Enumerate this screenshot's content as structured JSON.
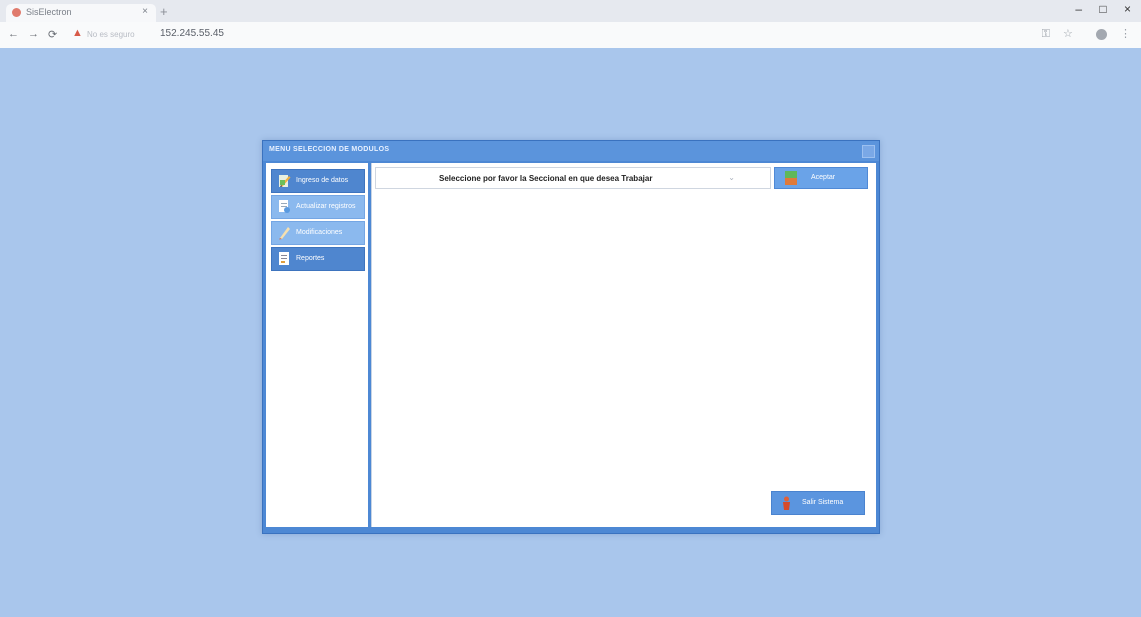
{
  "browser": {
    "tab_title": "SisElectron",
    "tab_close": "×",
    "new_tab": "+",
    "security_label": "No es seguro",
    "url": "152.245.55.45",
    "window_controls": {
      "minimize": "–",
      "maximize": "□",
      "close": "×"
    }
  },
  "dialog": {
    "title": "MENU SELECCION DE MODULOS",
    "sidebar": [
      {
        "label": "Ingreso de datos",
        "icon": "pencil-edit-icon",
        "style": "dark"
      },
      {
        "label": "Actualizar registros",
        "icon": "refresh-doc-icon",
        "style": "light"
      },
      {
        "label": "Modificaciones",
        "icon": "pen-icon",
        "style": "light"
      },
      {
        "label": "Reportes",
        "icon": "report-icon",
        "style": "dark"
      }
    ],
    "selector": {
      "text": "Seleccione por favor la Seccional en que desea Trabajar",
      "arrow": "⌄"
    },
    "accept_label": "Aceptar",
    "logout_label": "Salir Sistema"
  },
  "colors": {
    "page_bg": "#a9c6ec",
    "dialog_frame": "#4d88d4",
    "button_blue": "#6aa3e8",
    "warning_red": "#d85a48"
  }
}
